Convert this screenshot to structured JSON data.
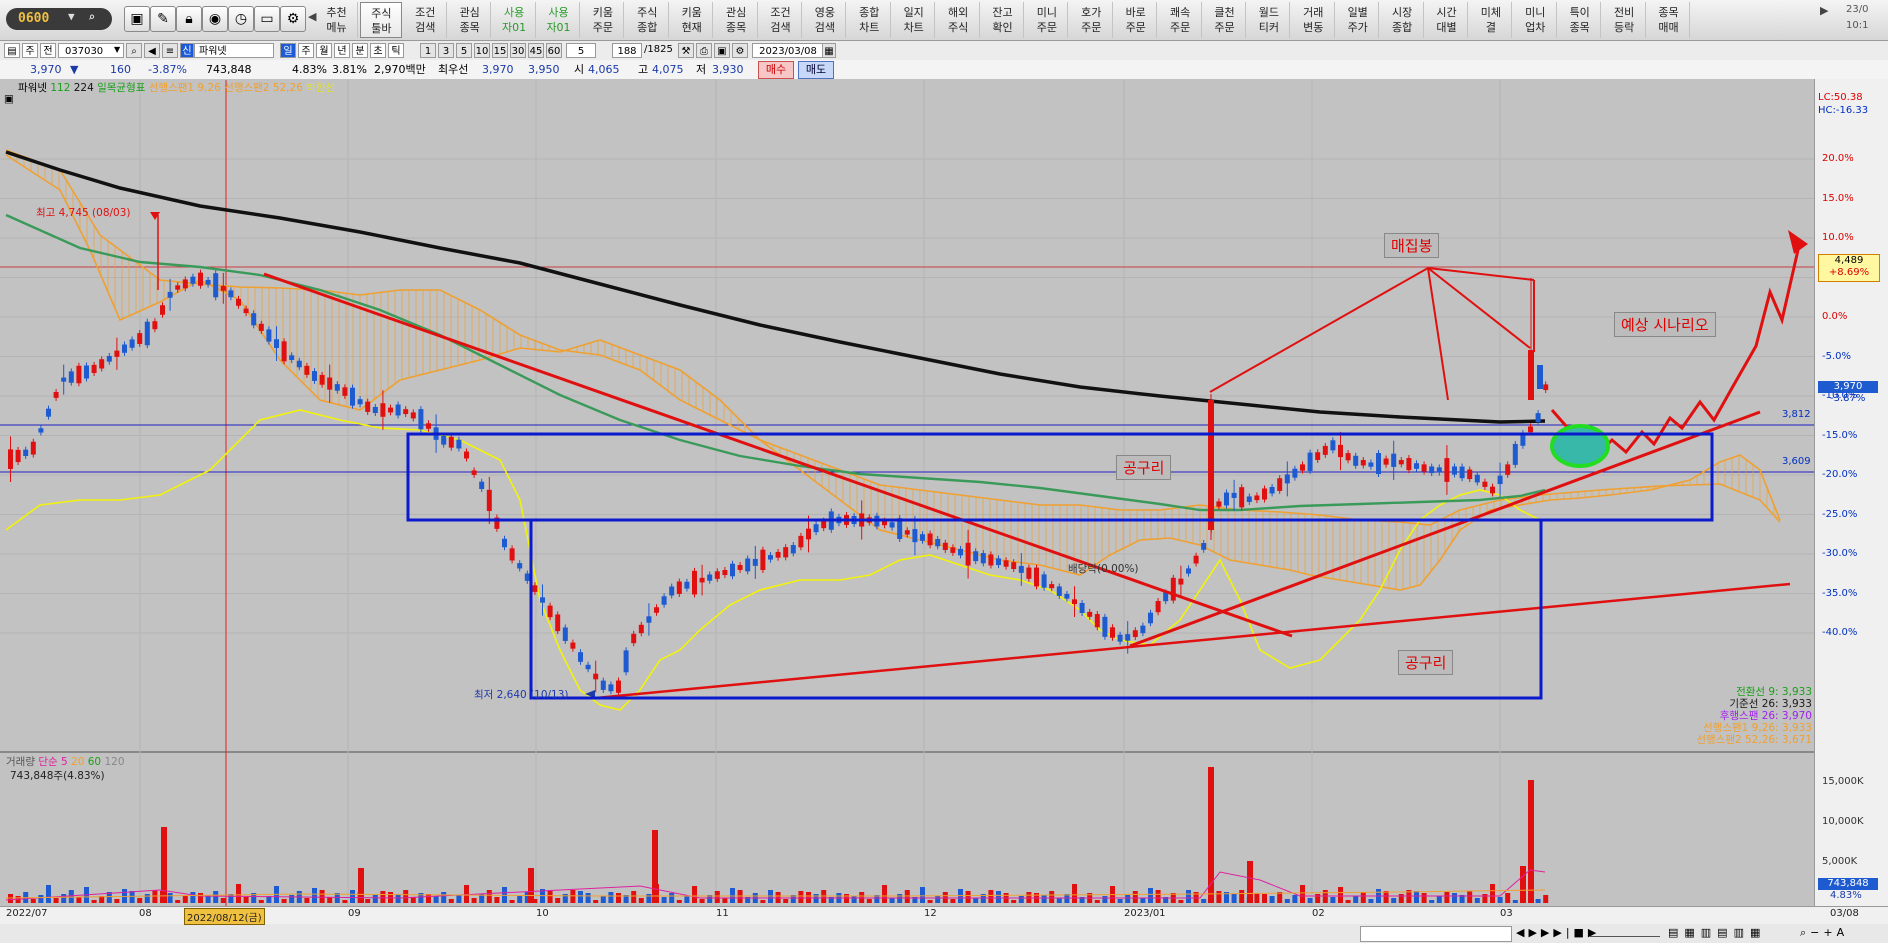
{
  "toolbar": {
    "screen_no": "0600",
    "menus": [
      {
        "label": "추천\n메뉴",
        "style": "normal"
      },
      {
        "label": "주식\n툴바",
        "style": "selected"
      },
      {
        "label": "조건\n검색",
        "style": "normal"
      },
      {
        "label": "관심\n종목",
        "style": "normal"
      },
      {
        "label": "사용\n자01",
        "style": "green"
      },
      {
        "label": "사용\n자01",
        "style": "green"
      },
      {
        "label": "키움\n주문",
        "style": "normal"
      },
      {
        "label": "주식\n종합",
        "style": "normal"
      },
      {
        "label": "키움\n현재",
        "style": "normal"
      },
      {
        "label": "관심\n종목",
        "style": "normal"
      },
      {
        "label": "조건\n검색",
        "style": "normal"
      },
      {
        "label": "영웅\n검색",
        "style": "normal"
      },
      {
        "label": "종합\n차트",
        "style": "normal"
      },
      {
        "label": "일지\n차트",
        "style": "normal"
      },
      {
        "label": "해외\n주식",
        "style": "normal"
      },
      {
        "label": "잔고\n확인",
        "style": "normal"
      },
      {
        "label": "미니\n주문",
        "style": "normal"
      },
      {
        "label": "호가\n주문",
        "style": "normal"
      },
      {
        "label": "바로\n주문",
        "style": "normal"
      },
      {
        "label": "쾌속\n주문",
        "style": "normal"
      },
      {
        "label": "클천\n주문",
        "style": "normal"
      },
      {
        "label": "월드\n티커",
        "style": "normal"
      },
      {
        "label": "거래\n변동",
        "style": "normal"
      },
      {
        "label": "일별\n주가",
        "style": "normal"
      },
      {
        "label": "시장\n종합",
        "style": "normal"
      },
      {
        "label": "시간\n대별",
        "style": "normal"
      },
      {
        "label": "미체\n결",
        "style": "normal"
      },
      {
        "label": "미니\n업차",
        "style": "normal"
      },
      {
        "label": "특이\n종목",
        "style": "normal"
      },
      {
        "label": "전비\n등락",
        "style": "normal"
      },
      {
        "label": "종목\n매매",
        "style": "normal"
      }
    ],
    "clock_date": "23/0",
    "clock_time": "10:1"
  },
  "bar2": {
    "period_day": "주",
    "period_prev": "전",
    "code": "037030",
    "badge": "신",
    "name": "파워넷",
    "units": [
      "일",
      "주",
      "월",
      "년",
      "분",
      "초",
      "틱"
    ],
    "minutes": [
      "1",
      "3",
      "5",
      "10",
      "15",
      "30",
      "45",
      "60"
    ],
    "count": "5",
    "range": "188",
    "total": "/1825",
    "date": "2023/03/08"
  },
  "quote": {
    "price": "3,970",
    "arrow": "▼",
    "change": "160",
    "pct": "-3.87%",
    "volume": "743,848",
    "vol_pct": "4.83%",
    "turnover": "3.81%",
    "amount": "2,970백만",
    "best_bid_label": "최우선",
    "best_ask": "3,970",
    "best_bid": "3,950",
    "open_label": "시",
    "open": "4,065",
    "high_label": "고",
    "high": "4,075",
    "low_label": "저",
    "low": "3,930",
    "buy": "매수",
    "sell": "매도"
  },
  "legend_top": {
    "name": "파워넷",
    "ma1": "112",
    "ma2": "224",
    "ichimoku": "일목균형표",
    "span1": "선행스팬1 9,26",
    "span2": "선행스팬2 52,26",
    "lagging": "하한선"
  },
  "annotations": {
    "high_label": "최고 4,745 (08/03)",
    "low_label": "최저 2,640 (10/13)",
    "dividend": "배당락(0.00%)",
    "collect": "매집봉",
    "scenario": "예상 시나리오",
    "neck1": "공구리",
    "neck2": "공구리"
  },
  "right_values": {
    "lc": "LC:50.38",
    "hc": "HC:-16.33",
    "cur_price": "4,489",
    "cur_pct": "+8.69%",
    "price_box": "3,970",
    "price_pct": "-3.87%",
    "level1": "3,812",
    "level2": "3,609",
    "vol_box": "743,848",
    "vol_pct": "4.83%"
  },
  "ichimoku_values": [
    {
      "label": "전환선 9: 3,933",
      "color": "#1aa01a"
    },
    {
      "label": "기준선 26: 3,933",
      "color": "#1a1a1a"
    },
    {
      "label": "후행스팬 26: 3,970",
      "color": "#a020f0"
    },
    {
      "label": "선행스팬1 9,26: 3,933",
      "color": "#f0a030"
    },
    {
      "label": "선행스팬2 52,26: 3,671",
      "color": "#f0a030"
    }
  ],
  "pct_axis": [
    "20.0%",
    "15.0%",
    "10.0%",
    "5.0%",
    "0.0%",
    "-5.0%",
    "-10.0%",
    "-15.0%",
    "-20.0%",
    "-25.0%",
    "-30.0%",
    "-35.0%",
    "-40.0%"
  ],
  "vol_axis": [
    "15,000K",
    "10,000K",
    "5,000K"
  ],
  "vol_legend": {
    "name": "거래량",
    "simple": "단순 5",
    "ma20": "20",
    "ma60": "60",
    "ma120": "120",
    "value": "743,848주(4.83%)"
  },
  "x_axis": {
    "labels": [
      "2022/07",
      "08",
      "2022/08/12(금)",
      "09",
      "10",
      "11",
      "12",
      "2023/01",
      "02",
      "03",
      "03/08"
    ]
  },
  "colors": {
    "up": "#e01010",
    "down": "#1e5ad0",
    "ma_black": "#111111",
    "ma_green": "#3a9a5a",
    "cloud": "#f0a030",
    "lagging": "#f2f20a",
    "trend": "#e01010",
    "box": "#0a1acc"
  }
}
